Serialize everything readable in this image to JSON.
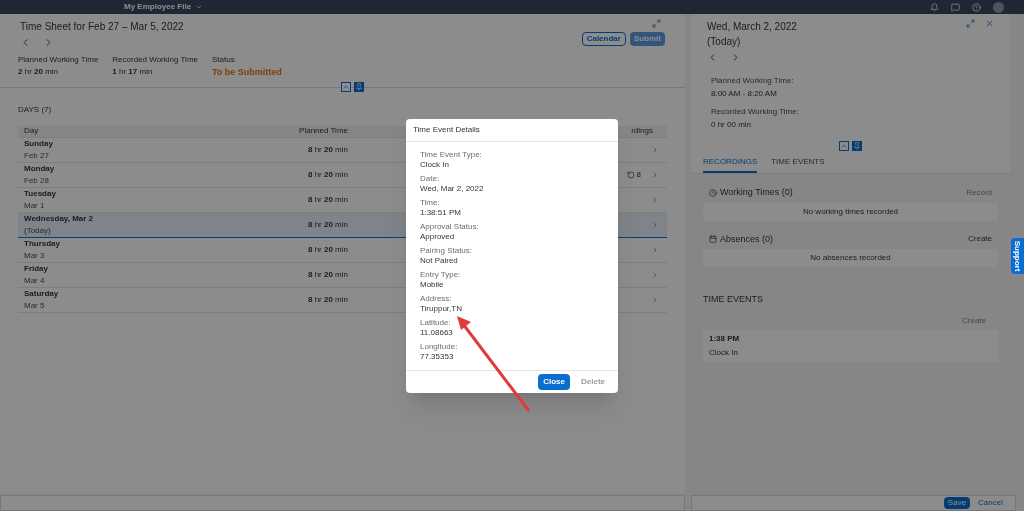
{
  "shell_bar": {
    "title": "My Employee File"
  },
  "timesheet": {
    "title": "Time Sheet for Feb 27 – Mar 5, 2022",
    "actions": [
      {
        "label": "Calendar",
        "disabled": false
      },
      {
        "label": "Submit",
        "disabled": true
      }
    ],
    "summary": [
      {
        "label": "Planned Working Time",
        "value": "**2** hr **20** min",
        "kind": "time"
      },
      {
        "label": "Recorded Working Time",
        "value": "**1** hr **17** min",
        "kind": "time"
      },
      {
        "label": "Status",
        "value": "To be Submitted",
        "kind": "status"
      }
    ],
    "days_title": "DAYS (7)",
    "table": {
      "columns": [
        "Day",
        "Planned Time",
        "rdings"
      ],
      "rows": [
        {
          "day": "Sunday",
          "date": "Feb 27",
          "planned": "**8** hr **20** min",
          "recordings": "",
          "selected": false
        },
        {
          "day": "Monday",
          "date": "Feb 28",
          "planned": "**8** hr **20** min",
          "recordings": "8",
          "selected": false
        },
        {
          "day": "Tuesday",
          "date": "Mar 1",
          "planned": "**8** hr **20** min",
          "recordings": "",
          "selected": false
        },
        {
          "day": "Wednesday, Mar 2",
          "date": "(Today)",
          "planned": "**8** hr **20** min",
          "recordings": "",
          "selected": true
        },
        {
          "day": "Thursday",
          "date": "Mar 3",
          "planned": "**8** hr **20** min",
          "recordings": "",
          "selected": false
        },
        {
          "day": "Friday",
          "date": "Mar 4",
          "planned": "**8** hr **20** min",
          "recordings": "",
          "selected": false
        },
        {
          "day": "Saturday",
          "date": "Mar 5",
          "planned": "**8** hr **20** min",
          "recordings": "",
          "selected": false
        }
      ]
    }
  },
  "detail": {
    "title": "Wed, March 2, 2022",
    "subtitle": "(Today)",
    "fields": [
      {
        "label": "Planned Working Time:",
        "value": "8:00 AM - 8:20 AM"
      },
      {
        "label": "Recorded Working Time:",
        "value": "0 hr 00 min"
      }
    ],
    "tabs": [
      {
        "label": "RECORDINGS",
        "selected": true
      },
      {
        "label": "TIME EVENTS",
        "selected": false
      }
    ],
    "sections": [
      {
        "title": "Working Times (0)",
        "action": "Record",
        "action_disabled": true,
        "empty": "No working times recorded",
        "kind": "working"
      },
      {
        "title": "Absences (0)",
        "action": "Create",
        "action_disabled": false,
        "empty": "No absences recorded",
        "kind": "absence"
      }
    ],
    "time_events": {
      "title": "TIME EVENTS",
      "action": "Create",
      "action_disabled": true,
      "events": [
        {
          "time": "1:38 PM",
          "type": "Clock In"
        }
      ]
    }
  },
  "footer": {
    "actions": [
      {
        "label": "Save",
        "primary": true
      },
      {
        "label": "Cancel",
        "primary": false
      }
    ]
  },
  "support_tab": "Support",
  "dialog": {
    "title": "Time Event Details",
    "fields": [
      {
        "label": "Time Event Type:",
        "value": "Clock In"
      },
      {
        "label": "Date:",
        "value": "Wed, Mar 2, 2022"
      },
      {
        "label": "Time:",
        "value": "1:38:51 PM"
      },
      {
        "label": "Approval Status:",
        "value": "Approved"
      },
      {
        "label": "Pairing Status:",
        "value": "Not Paired"
      },
      {
        "label": "Entry Type:",
        "value": "Mobile"
      },
      {
        "label": "Address:",
        "value": "Tiruppur,TN"
      },
      {
        "label": "Latitude:",
        "value": "11.08663"
      },
      {
        "label": "Longitude:",
        "value": "77.35353"
      }
    ],
    "buttons": [
      {
        "label": "Close",
        "primary": true,
        "disabled": false
      },
      {
        "label": "Delete",
        "primary": false,
        "disabled": true
      }
    ]
  }
}
